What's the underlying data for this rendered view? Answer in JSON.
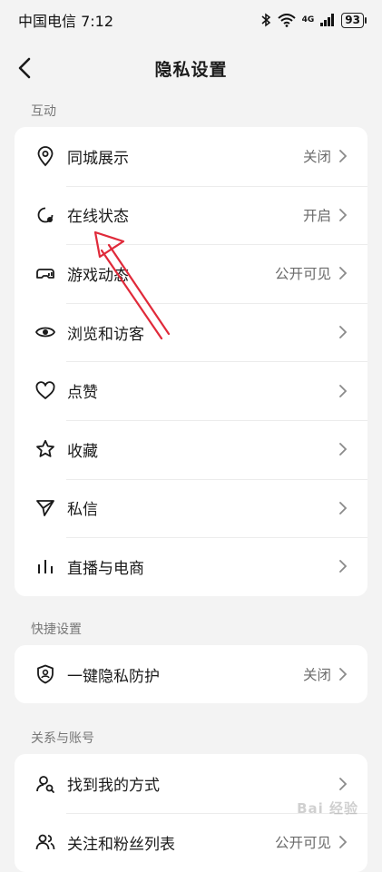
{
  "status_bar": {
    "carrier_time": "中国电信 7:12",
    "signal_label": "4G",
    "battery": "93"
  },
  "header": {
    "title": "隐私设置"
  },
  "sections": [
    {
      "label": "互动",
      "items": [
        {
          "label": "同城展示",
          "value": "关闭",
          "icon": "location-pin-icon"
        },
        {
          "label": "在线状态",
          "value": "开启",
          "icon": "online-status-icon"
        },
        {
          "label": "游戏动态",
          "value": "公开可见",
          "icon": "gamepad-icon"
        },
        {
          "label": "浏览和访客",
          "value": "",
          "icon": "eye-icon"
        },
        {
          "label": "点赞",
          "value": "",
          "icon": "heart-icon"
        },
        {
          "label": "收藏",
          "value": "",
          "icon": "star-icon"
        },
        {
          "label": "私信",
          "value": "",
          "icon": "send-icon"
        },
        {
          "label": "直播与电商",
          "value": "",
          "icon": "bar-chart-icon"
        }
      ]
    },
    {
      "label": "快捷设置",
      "items": [
        {
          "label": "一键隐私防护",
          "value": "关闭",
          "icon": "shield-user-icon"
        }
      ]
    },
    {
      "label": "关系与账号",
      "items": [
        {
          "label": "找到我的方式",
          "value": "",
          "icon": "find-user-icon"
        },
        {
          "label": "关注和粉丝列表",
          "value": "公开可见",
          "icon": "users-icon"
        }
      ]
    }
  ],
  "watermark": "Bai 经验",
  "colors": {
    "annotation_arrow": "#e02a3a",
    "background": "#f3f3f3"
  }
}
